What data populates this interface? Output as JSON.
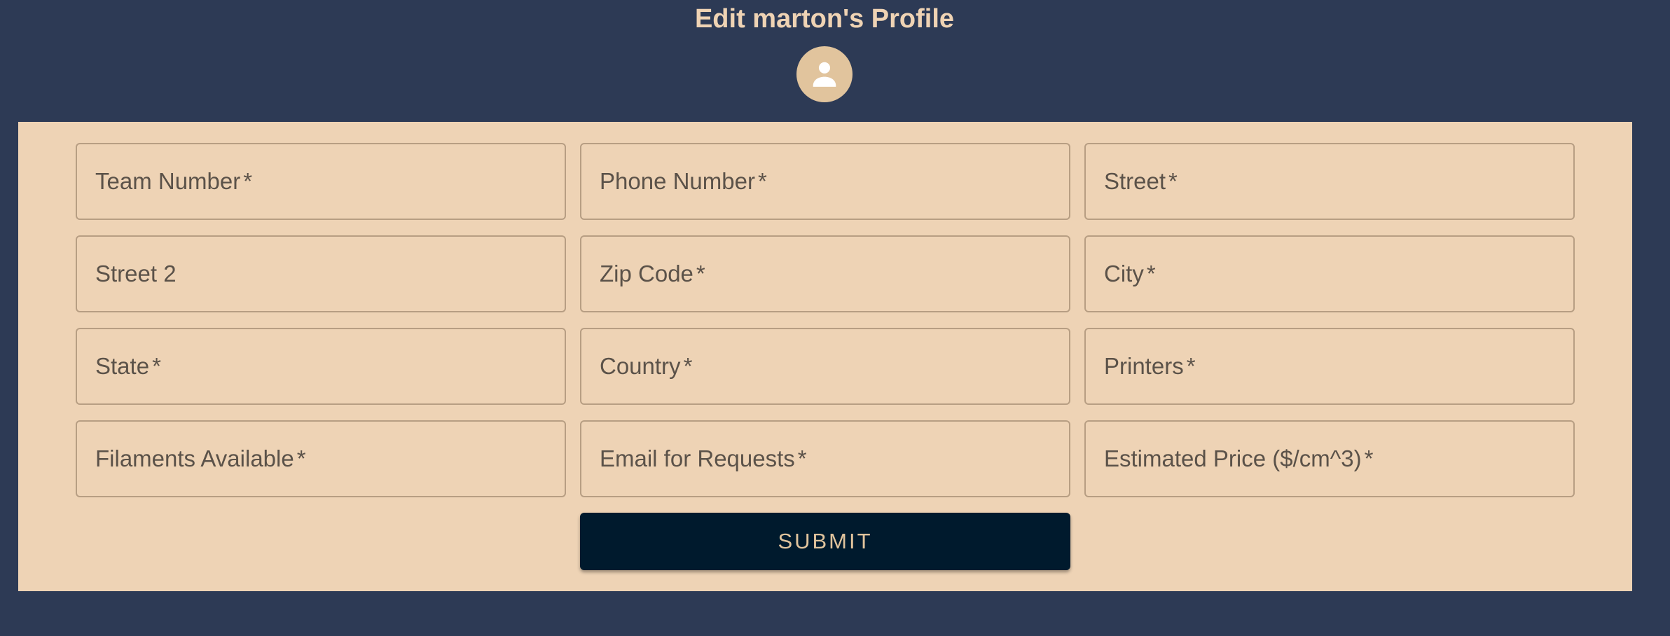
{
  "header": {
    "title": "Edit marton's Profile",
    "avatar_icon": "person-icon"
  },
  "form": {
    "fields": [
      {
        "label": "Team Number",
        "required": "*"
      },
      {
        "label": "Phone Number",
        "required": "*"
      },
      {
        "label": "Street",
        "required": "*"
      },
      {
        "label": "Street 2",
        "required": ""
      },
      {
        "label": "Zip Code",
        "required": "*"
      },
      {
        "label": "City",
        "required": "*"
      },
      {
        "label": "State",
        "required": "*"
      },
      {
        "label": "Country",
        "required": "*"
      },
      {
        "label": "Printers",
        "required": "*"
      },
      {
        "label": "Filaments Available",
        "required": "*"
      },
      {
        "label": "Email for Requests",
        "required": "*"
      },
      {
        "label": "Estimated Price ($/cm^3)",
        "required": "*"
      }
    ],
    "submit_label": "SUBMIT"
  },
  "colors": {
    "background": "#2d3a55",
    "panel": "#eed3b5",
    "title": "#efd3b4",
    "avatar": "#e1c49d",
    "submit_bg": "#001a2d",
    "submit_text": "#e1c49d"
  }
}
